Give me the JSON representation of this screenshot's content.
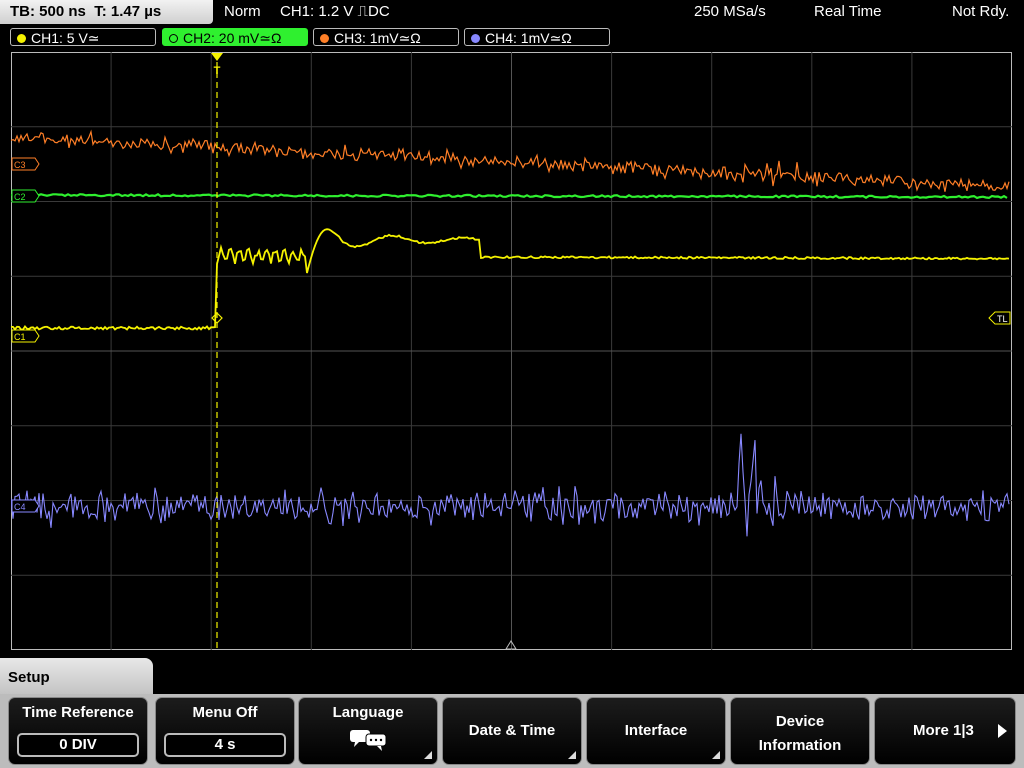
{
  "status": {
    "timebase": "TB: 500 ns",
    "trigger_time": "T: 1.47 µs",
    "mode": "Norm",
    "trigger_setup": "CH1: 1.2 V ⎍DC",
    "sample_rate": "250 MSa/s",
    "acquisition": "Real Time",
    "state": "Not Rdy."
  },
  "channels": [
    {
      "label": "CH1: 5 V≃",
      "color": "#f5f200"
    },
    {
      "label": "CH2: 20 mV≃Ω",
      "color": "#2ff02f"
    },
    {
      "label": "CH3: 1mV≃Ω",
      "color": "#ff7f27"
    },
    {
      "label": "CH4: 1mV≃Ω",
      "color": "#8888ff"
    }
  ],
  "waveform": {
    "marker_c3": "C3",
    "marker_c2": "C2",
    "marker_c1": "C1",
    "marker_c4": "C4",
    "trigger_level": "TL",
    "trigger_marker": "T",
    "grid_color": "#3a3a3a",
    "trace_colors": {
      "ch1": "#f5f200",
      "ch2": "#2ff02f",
      "ch3": "#ff7f27",
      "ch4": "#8888ff"
    }
  },
  "menu": {
    "title": "Setup",
    "buttons": {
      "time_reference": "Time Reference",
      "time_reference_value": "0 DIV",
      "menu_off": "Menu Off",
      "menu_off_value": "4 s",
      "language": "Language",
      "date_time": "Date & Time",
      "interface": "Interface",
      "device_line1": "Device",
      "device_line2": "Information",
      "more": "More 1|3"
    },
    "icons": {
      "language": "speech-bubbles-icon",
      "more": "arrow-right-icon"
    }
  }
}
